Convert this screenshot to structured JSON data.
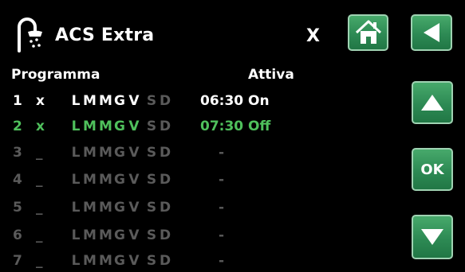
{
  "header": {
    "title": "ACS Extra",
    "close_label": "X"
  },
  "buttons": {
    "ok_label": "OK"
  },
  "table": {
    "col_program": "Programma",
    "col_active": "Attiva",
    "rows": [
      {
        "num": "1",
        "mark": "x",
        "days": [
          "L",
          "M",
          "M",
          "G",
          "V",
          "S",
          "D"
        ],
        "time": "06:30",
        "state": "On"
      },
      {
        "num": "2",
        "mark": "x",
        "days": [
          "L",
          "M",
          "M",
          "G",
          "V",
          "S",
          "D"
        ],
        "time": "07:30",
        "state": "Off"
      },
      {
        "num": "3",
        "mark": "_",
        "days": [
          "L",
          "M",
          "M",
          "G",
          "V",
          "S",
          "D"
        ],
        "time": "-",
        "state": ""
      },
      {
        "num": "4",
        "mark": "_",
        "days": [
          "L",
          "M",
          "M",
          "G",
          "V",
          "S",
          "D"
        ],
        "time": "-",
        "state": ""
      },
      {
        "num": "5",
        "mark": "_",
        "days": [
          "L",
          "M",
          "M",
          "G",
          "V",
          "S",
          "D"
        ],
        "time": "-",
        "state": ""
      },
      {
        "num": "6",
        "mark": "_",
        "days": [
          "L",
          "M",
          "M",
          "G",
          "V",
          "S",
          "D"
        ],
        "time": "-",
        "state": ""
      },
      {
        "num": "7",
        "mark": "_",
        "days": [
          "L",
          "M",
          "M",
          "G",
          "V",
          "S",
          "D"
        ],
        "time": "-",
        "state": ""
      }
    ]
  },
  "colors": {
    "accent_green": "#2d8a54",
    "selected_text": "#4fc05c",
    "inactive_text": "#5a5a5a"
  },
  "icons": [
    "shower-icon",
    "home-icon",
    "back-arrow-icon",
    "up-arrow-icon",
    "down-arrow-icon"
  ]
}
